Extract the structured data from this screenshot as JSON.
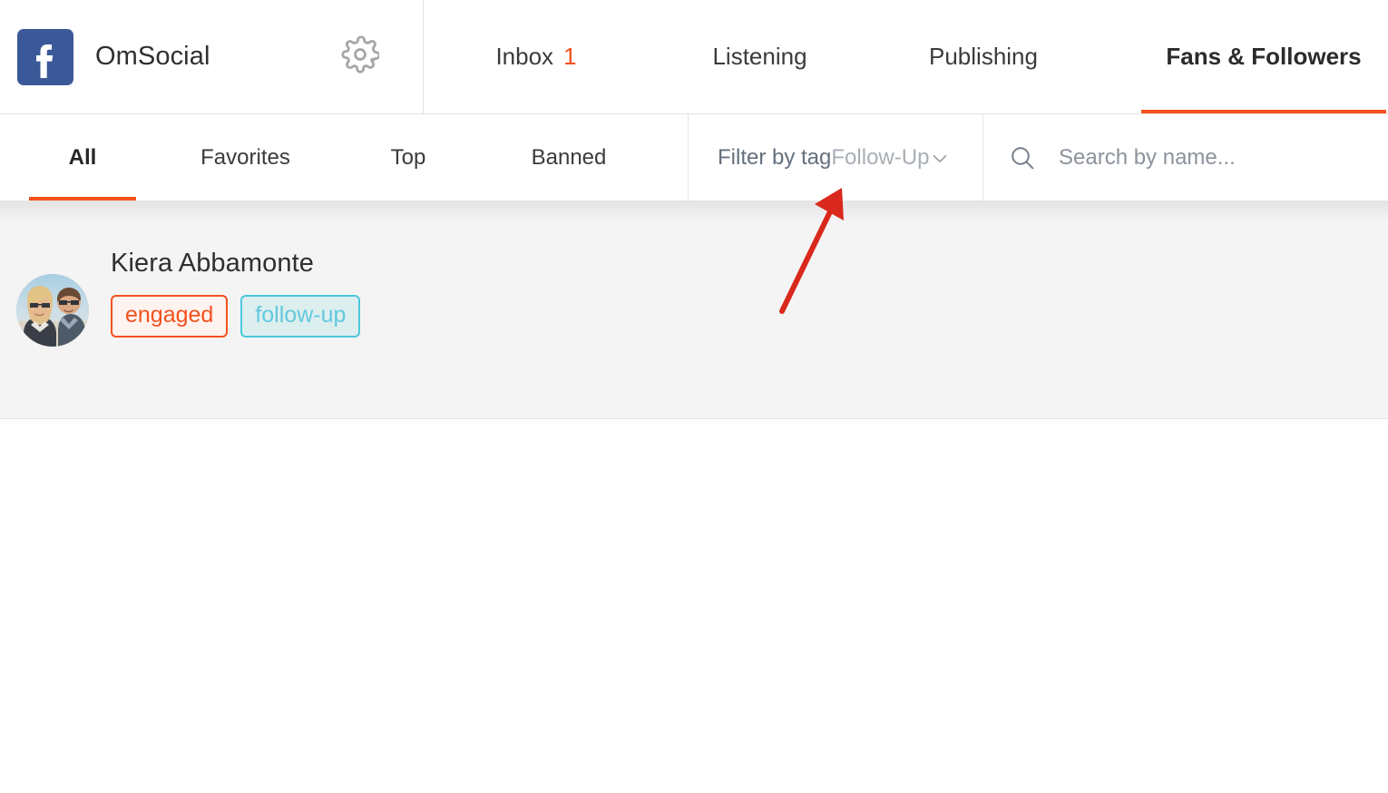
{
  "header": {
    "brand_name": "OmSocial",
    "logo_icon": "facebook-logo",
    "settings_icon": "gear-icon",
    "nav_tabs": [
      {
        "label": "Inbox",
        "badge": "1",
        "active": false
      },
      {
        "label": "Listening",
        "badge": "",
        "active": false
      },
      {
        "label": "Publishing",
        "badge": "",
        "active": false
      },
      {
        "label": "Fans & Followers",
        "badge": "",
        "active": true
      }
    ]
  },
  "subnav": {
    "tabs": [
      {
        "label": "All",
        "active": true
      },
      {
        "label": "Favorites",
        "active": false
      },
      {
        "label": "Top",
        "active": false
      },
      {
        "label": "Banned",
        "active": false
      }
    ],
    "filter": {
      "label": "Filter by tag",
      "value": "Follow-Up",
      "chevron_icon": "chevron-down-icon"
    },
    "search": {
      "icon": "search-icon",
      "placeholder": "Search by name...",
      "value": ""
    }
  },
  "list": {
    "people": [
      {
        "name": "Kiera Abbamonte",
        "avatar_icon": "user-avatar-photo",
        "tags": [
          {
            "label": "engaged",
            "color": "#f4511e"
          },
          {
            "label": "follow-up",
            "color": "#4bc8dc"
          }
        ]
      }
    ]
  },
  "annotation": {
    "type": "arrow",
    "color": "#d9291c",
    "points_to": "filter-by-tag-dropdown"
  },
  "colors": {
    "accent": "#f4511e",
    "facebook_blue": "#3b5998",
    "tag_teal": "#4bc8dc",
    "row_background": "#f4f4f4"
  }
}
